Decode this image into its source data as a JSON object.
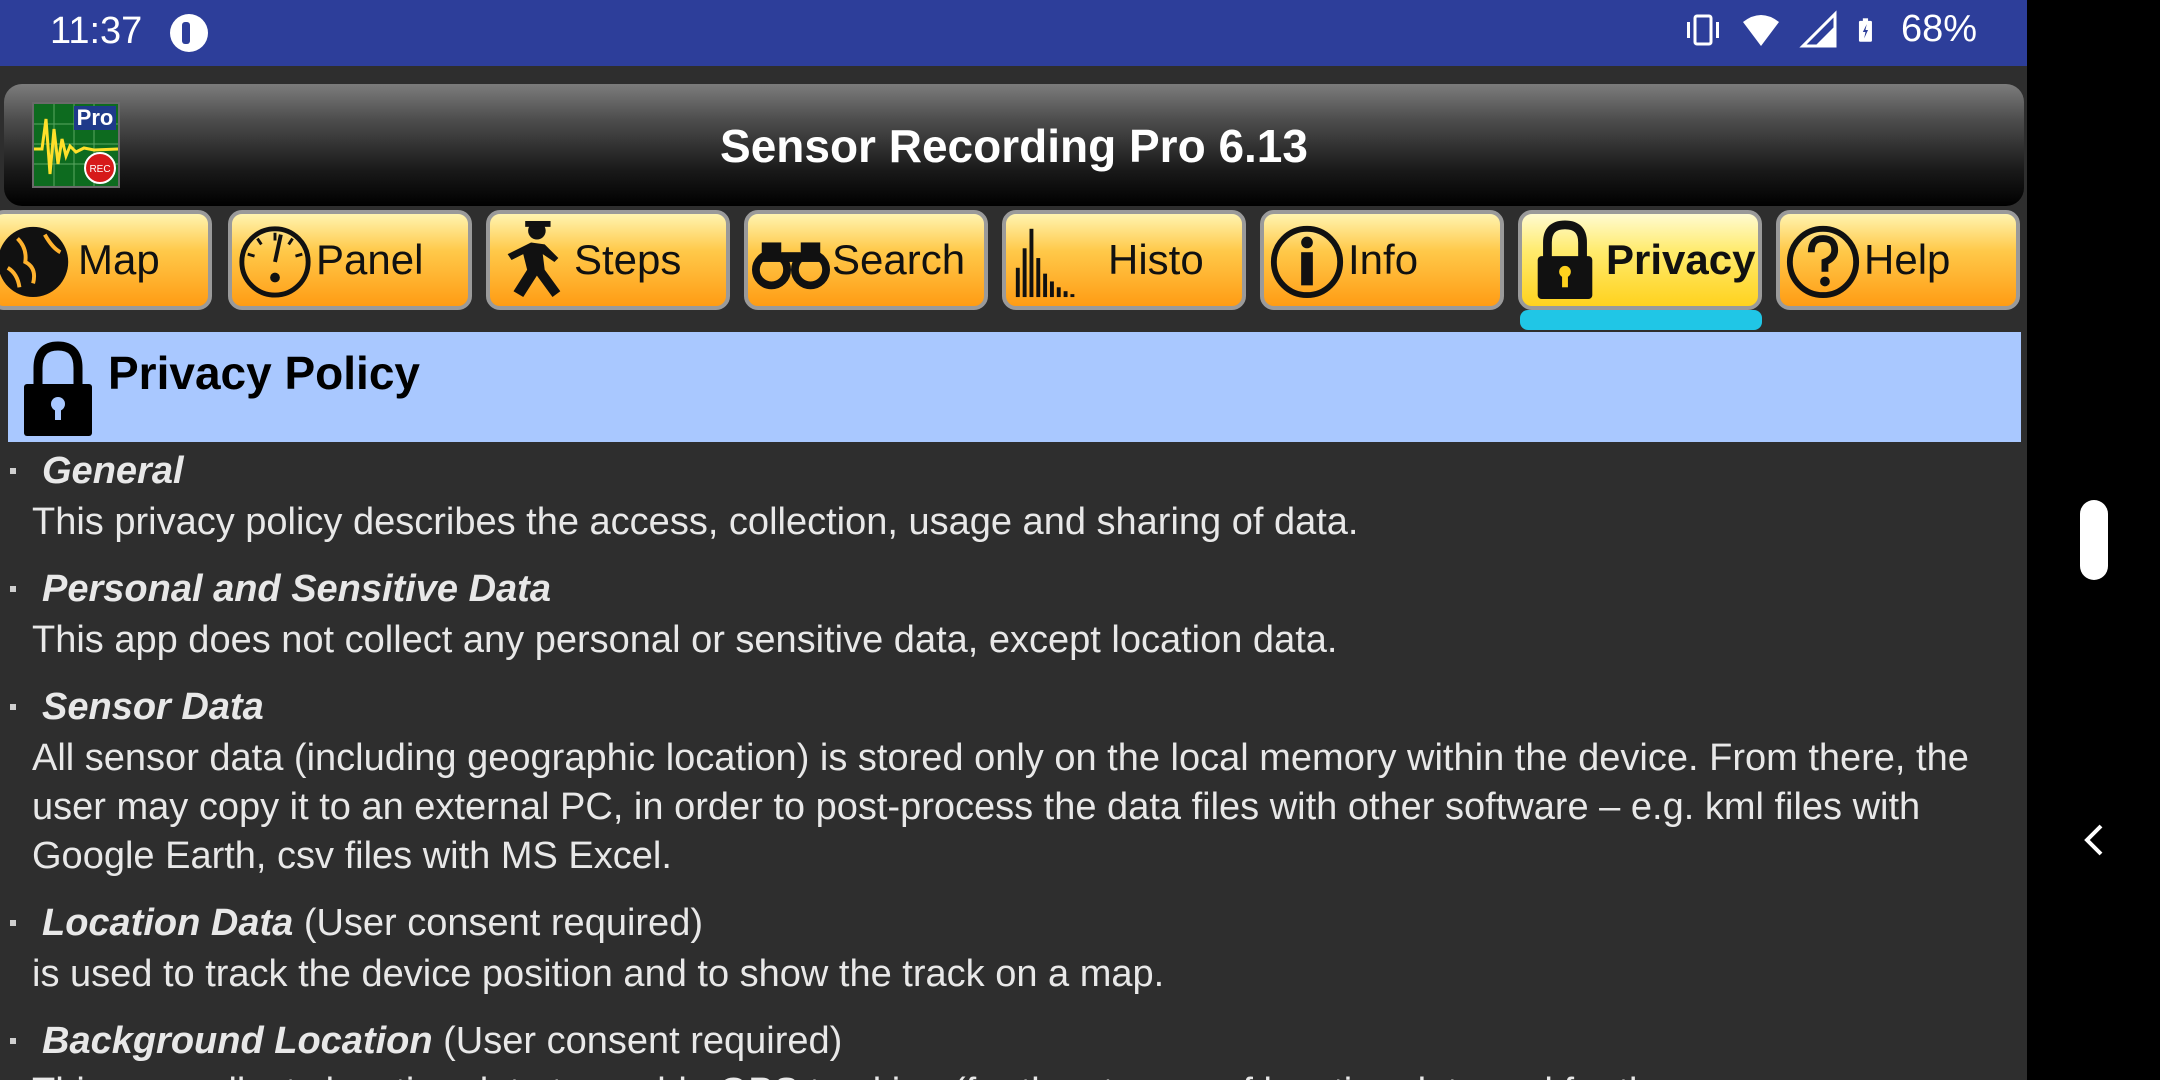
{
  "status_bar": {
    "time": "11:37",
    "battery": "68%"
  },
  "app": {
    "title": "Sensor Recording Pro 6.13",
    "logo_text": "Pro",
    "logo_badge": "REC"
  },
  "tabs": [
    {
      "label": "Map",
      "icon": "globe-icon"
    },
    {
      "label": "Panel",
      "icon": "gauge-icon"
    },
    {
      "label": "Steps",
      "icon": "walking-man-icon"
    },
    {
      "label": "Search",
      "icon": "binoculars-icon"
    },
    {
      "label": "Histo",
      "icon": "histogram-icon"
    },
    {
      "label": "Info",
      "icon": "info-icon"
    },
    {
      "label": "Privacy",
      "icon": "lock-icon",
      "active": true
    },
    {
      "label": "Help",
      "icon": "question-icon"
    }
  ],
  "privacy": {
    "title": "Privacy Policy",
    "sections": [
      {
        "heading": "General",
        "note": "",
        "body": "This privacy policy describes the access, collection, usage and sharing of data."
      },
      {
        "heading": "Personal and Sensitive Data",
        "note": "",
        "body": "This app does not collect any personal or sensitive data, except location data."
      },
      {
        "heading": "Sensor Data",
        "note": "",
        "body": "All sensor data (including geographic location) is stored only on the local memory within the device. From there, the user may copy it to an external PC, in order to post-process the data files with other software – e.g. kml files with Google Earth, csv files with MS Excel."
      },
      {
        "heading": "Location Data",
        "note": "(User consent required)",
        "body": "is used to track the device position and to show the track on a map."
      },
      {
        "heading": "Background Location",
        "note": "(User consent required)",
        "body": "This app collects location data to enable GPS tracking (for the storage of location data and for the"
      }
    ]
  },
  "colors": {
    "status_bar": "#2d3e9a",
    "content_bg": "#2e2e2e",
    "header_bg": "#a9c8ff",
    "tab_indicator": "#20c6e6",
    "tab_orange": "#ff9c14"
  }
}
